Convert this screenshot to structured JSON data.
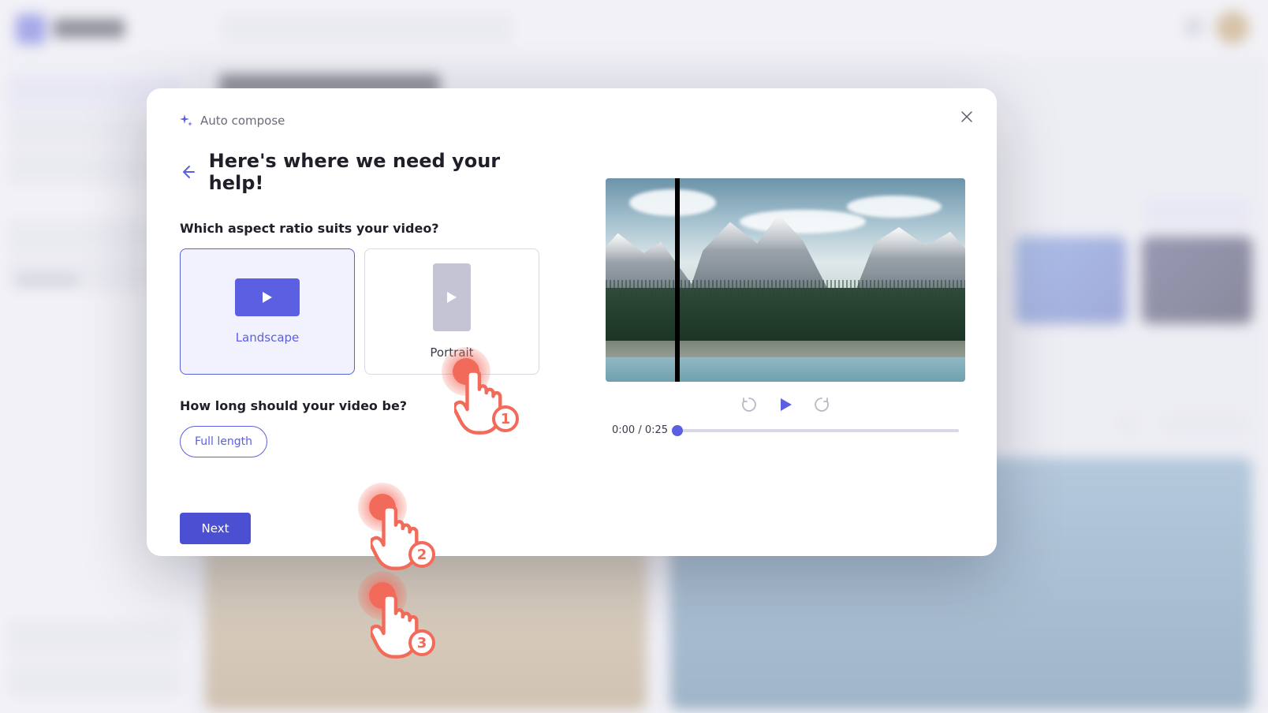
{
  "modal": {
    "breadcrumb_label": "Auto compose",
    "title": "Here's where we need your help!",
    "q_ratio": "Which aspect ratio suits your video?",
    "ratio_options": {
      "landscape": "Landscape",
      "portrait": "Portrait"
    },
    "q_length": "How long should your video be?",
    "length_options": {
      "full": "Full length"
    },
    "next_label": "Next",
    "time_display": "0:00 / 0:25"
  },
  "annotations": {
    "step1": "1",
    "step2": "2",
    "step3": "3"
  },
  "colors": {
    "primary": "#5b5fe1",
    "annotation": "#f26a5a"
  }
}
